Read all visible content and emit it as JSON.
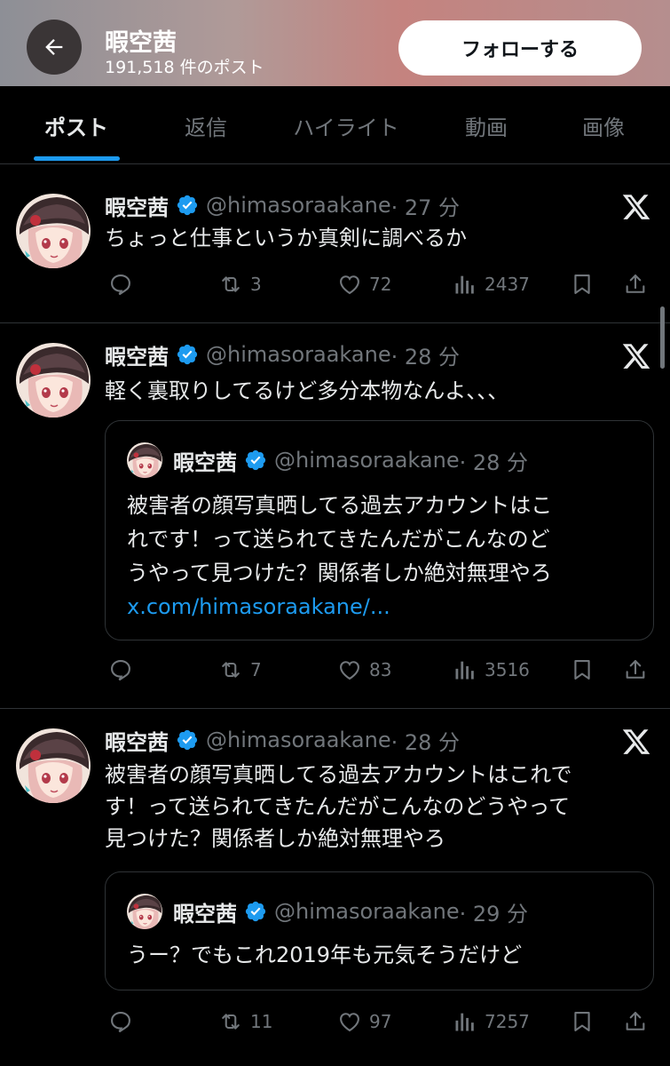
{
  "header": {
    "title": "暇空茜",
    "subtitle": "191,518 件のポスト",
    "follow_label": "フォローする"
  },
  "tabs": [
    "ポスト",
    "返信",
    "ハイライト",
    "動画",
    "画像"
  ],
  "posts": [
    {
      "name": "暇空茜",
      "handle": "@himasoraakane",
      "time": "· 27 分",
      "text": "ちょっと仕事というか真剣に調べるか",
      "replies": "",
      "reposts": "3",
      "likes": "72",
      "views": "2437"
    },
    {
      "name": "暇空茜",
      "handle": "@himasoraakane",
      "time": "· 28 分",
      "text": "軽く裏取りしてるけど多分本物なんよ、、、",
      "replies": "",
      "reposts": "7",
      "likes": "83",
      "views": "3516",
      "quote": {
        "name": "暇空茜",
        "handle": "@himasoraakane",
        "time": "· 28 分",
        "text_line1": "被害者の顔写真晒してる過去アカウントはこ",
        "text_line2": "れです！って送られてきたんだがこんなのど",
        "text_line3": "うやって見つけた？関係者しか絶対無理やろ",
        "link": "x.com/himasoraakane/..."
      }
    },
    {
      "name": "暇空茜",
      "handle": "@himasoraakane",
      "time": "· 28 分",
      "text_line1": "被害者の顔写真晒してる過去アカウントはこれで",
      "text_line2": "す！って送られてきたんだがこんなのどうやって",
      "text_line3": "見つけた？関係者しか絶対無理やろ",
      "replies": "",
      "reposts": "11",
      "likes": "97",
      "views": "7257",
      "quote": {
        "name": "暇空茜",
        "handle": "@himasoraakane",
        "time": "· 29 分",
        "text": "うー？でもこれ2019年も元気そうだけど"
      }
    }
  ],
  "colors": {
    "accent": "#1d9bf0",
    "muted": "#71767b",
    "text": "#e7e9ea",
    "border": "#2f3336"
  }
}
